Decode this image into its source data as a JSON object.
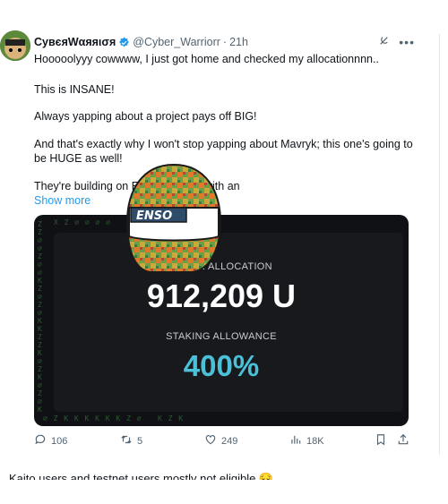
{
  "tweet": {
    "display_name": "CувєяWαяяισя",
    "handle": "@Cyber_Warriorr",
    "separator": "·",
    "time": "21h",
    "paragraphs": [
      "Hooooolyyy cowwww, I just got home and checked my allocationnnn..",
      "This is INSANE!",
      "Always yapping about a project pays off BIG!",
      "And that's exactly why I won't stop yapping about Mavryk; this one's going to be HUGE as well!",
      "They're building on Ethereum L2s with an"
    ],
    "show_more": "Show more",
    "media": {
      "helmet_text": "ENSO",
      "token_allocation_label": "TOKEN ALLOCATION",
      "token_allocation_value": "912,209 U",
      "staking_label": "STAKING ALLOWANCE",
      "staking_value": "400%",
      "accent_color": "#4bc0d9"
    },
    "stats": {
      "replies": "106",
      "retweets": "5",
      "likes": "249",
      "views": "18K"
    }
  },
  "next_tweet": {
    "text": "Kaito users and testnet users mostly not eligible 😔"
  },
  "icons": [
    "grok-icon",
    "more-icon",
    "verified-icon",
    "reply-icon",
    "retweet-icon",
    "like-icon",
    "views-icon",
    "bookmark-icon",
    "share-icon"
  ]
}
